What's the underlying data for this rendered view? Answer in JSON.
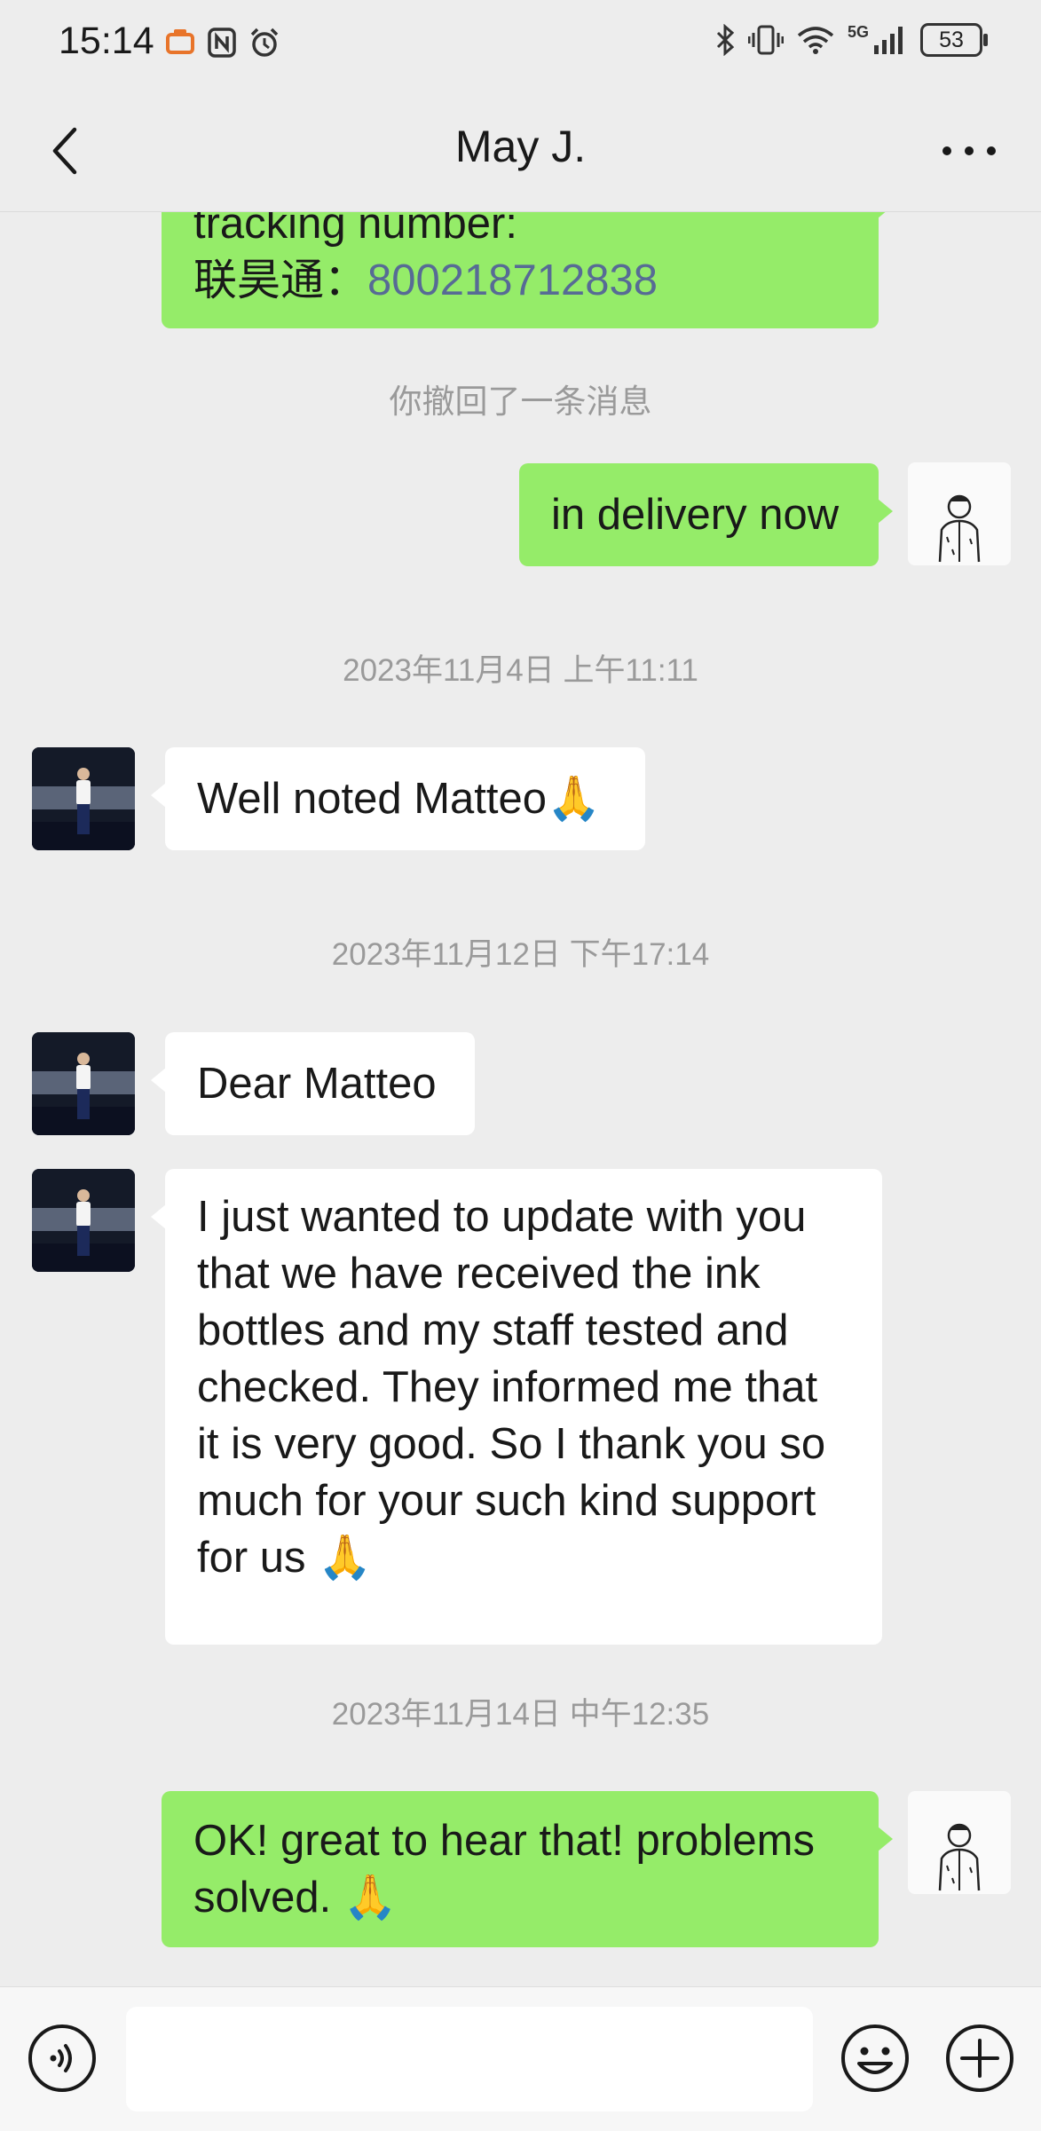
{
  "status_bar": {
    "time": "15:14",
    "battery": "53",
    "network": "5G"
  },
  "header": {
    "title": "May J."
  },
  "messages": {
    "m1": {
      "line1": "tracking number:",
      "line2_prefix": "联昊通：",
      "tracking": "800218712838"
    },
    "recall": "你撤回了一条消息",
    "m2": "in delivery now",
    "ts1": "2023年11月4日 上午11:11",
    "m3": "Well noted Matteo🙏",
    "ts2": "2023年11月12日 下午17:14",
    "m4": "Dear Matteo",
    "m5": [
      "I just wanted to update with you",
      "that we have received the ink",
      "bottles and my staff tested and",
      "checked. They informed me that",
      "it is very good. So I thank you so",
      "much for your such kind support",
      "for us 🙏"
    ],
    "ts3": "2023年11月14日 中午12:35",
    "m6": [
      "OK! great to hear that! problems",
      "solved. 🙏"
    ]
  },
  "colors": {
    "my_bubble": "#95ec69",
    "their_bubble": "#ffffff",
    "background": "#ededed",
    "link": "#576b95"
  },
  "icons": {
    "back": "chevron-left-icon",
    "more": "more-dots-icon",
    "voice": "voice-icon",
    "emoji": "emoji-icon",
    "plus": "plus-icon"
  }
}
